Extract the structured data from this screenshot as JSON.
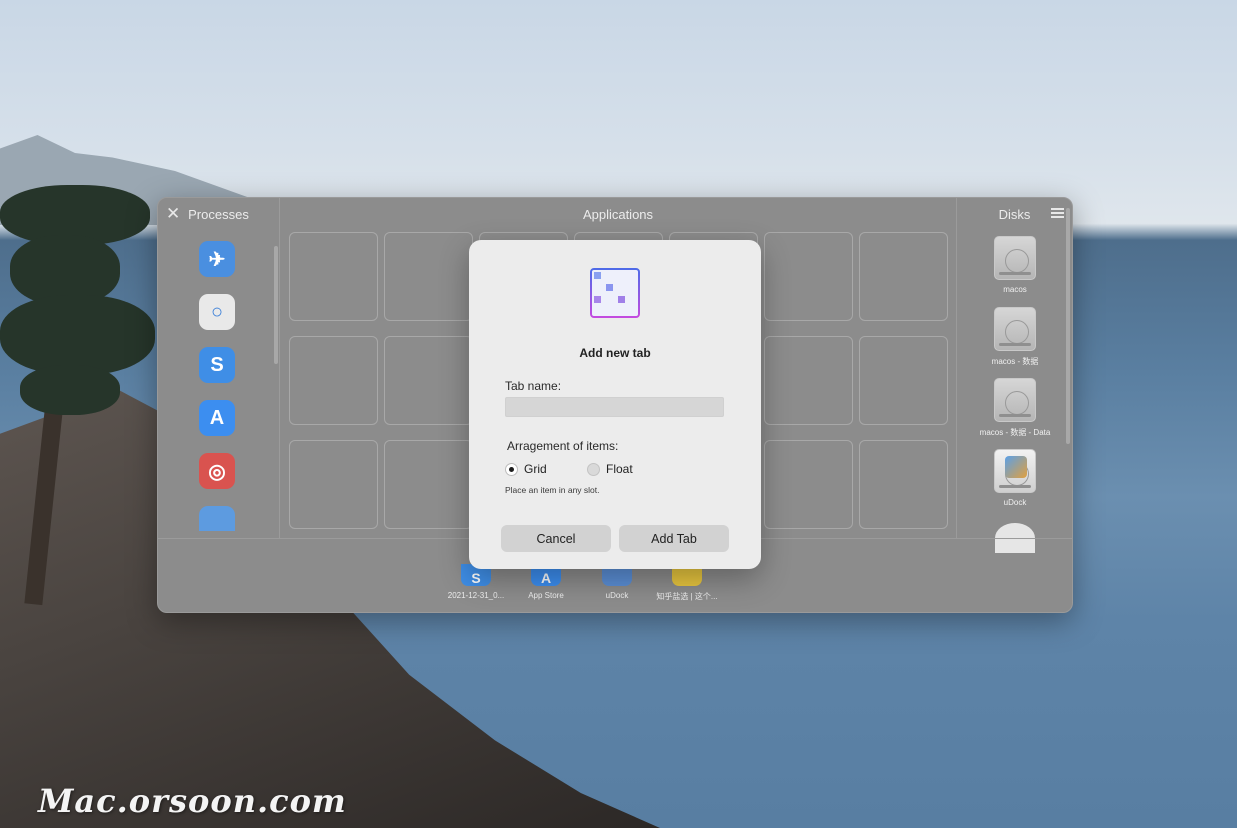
{
  "window": {
    "processes_title": "Processes",
    "applications_title": "Applications",
    "disks_title": "Disks"
  },
  "processes": [
    {
      "icon": "paper-plane-app-icon",
      "glyph": "✈",
      "color": "#4a8fe0"
    },
    {
      "icon": "chat-bubble-app-icon",
      "glyph": "○",
      "color": "#e9e9e9"
    },
    {
      "icon": "s-app-icon",
      "glyph": "S",
      "color": "#3f8ee6"
    },
    {
      "icon": "app-store-icon",
      "glyph": "A",
      "color": "#3c8ef0"
    },
    {
      "icon": "netease-music-icon",
      "glyph": "◎",
      "color": "#d9534f"
    },
    {
      "icon": "maps-app-icon",
      "glyph": "",
      "color": "#5d9be0"
    }
  ],
  "disks": [
    {
      "label": "macos"
    },
    {
      "label": "macos - 数据"
    },
    {
      "label": "macos - 数据 - Data"
    },
    {
      "label": "uDock"
    }
  ],
  "dock": [
    {
      "label": "2021-12-31_0...",
      "icon": "s-app-icon",
      "color": "#3f8ee6",
      "glyph": "S"
    },
    {
      "label": "App Store",
      "icon": "app-store-icon",
      "color": "#3c8ef0",
      "glyph": "A"
    },
    {
      "label": "uDock",
      "icon": "udock-icon",
      "color": "#5b8fd6",
      "glyph": ""
    },
    {
      "label": "知乎盐选 | 这个...",
      "icon": "chrome-icon",
      "color": "#e8c63f",
      "glyph": ""
    }
  ],
  "dialog": {
    "title": "Add new tab",
    "tab_name_label": "Tab name:",
    "tab_name_value": "",
    "arrangement_label": "Arragement of items:",
    "option_grid": "Grid",
    "option_float": "Float",
    "selected_option": "Grid",
    "hint": "Place an item in any slot.",
    "cancel_label": "Cancel",
    "add_label": "Add Tab"
  },
  "watermark": "Mac.orsoon.com"
}
